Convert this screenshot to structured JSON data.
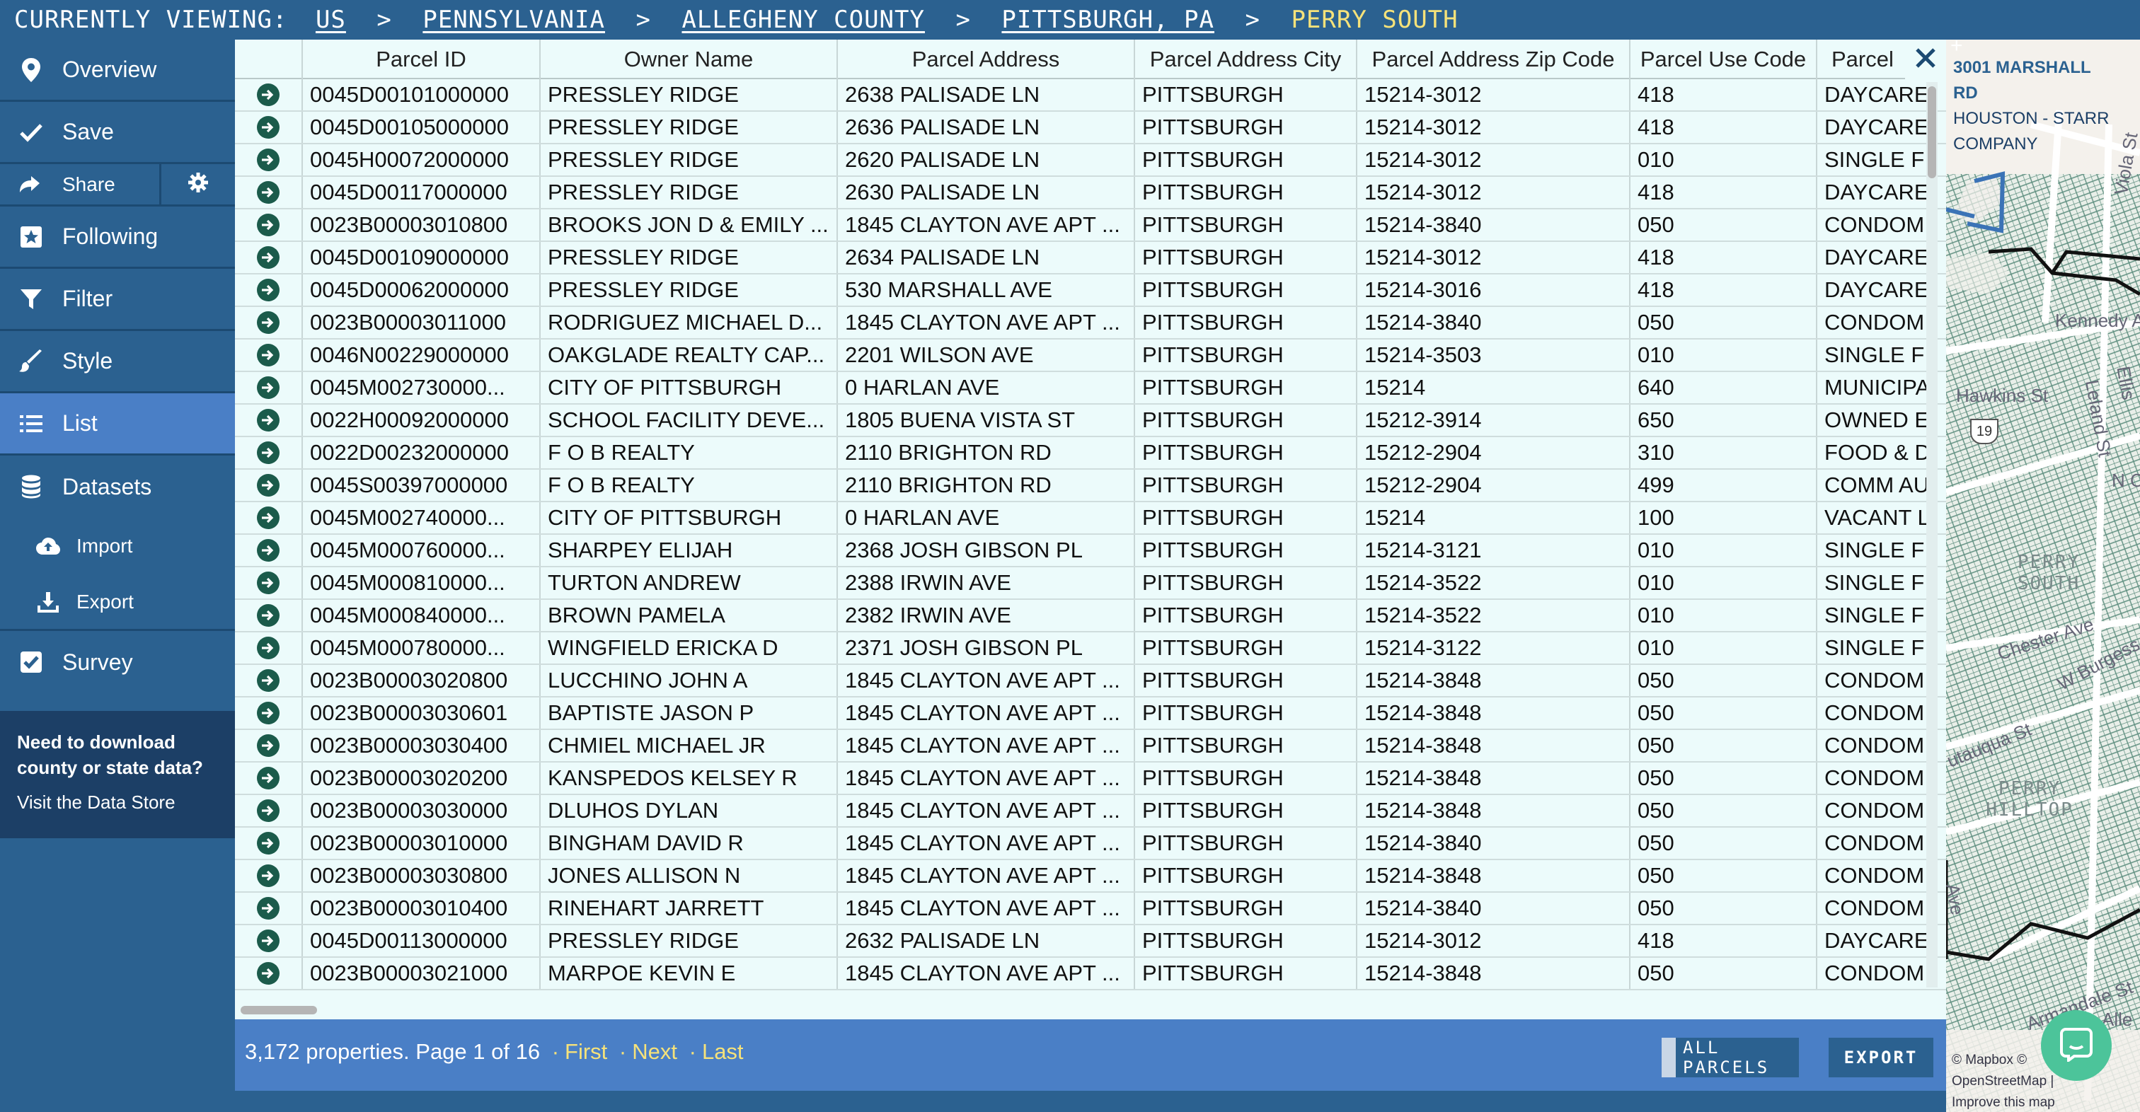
{
  "breadcrumb": {
    "prefix": "CURRENTLY VIEWING:",
    "crumbs": [
      "US",
      "PENNSYLVANIA",
      "ALLEGHENY COUNTY",
      "PITTSBURGH, PA"
    ],
    "separator": ">",
    "current": "PERRY SOUTH"
  },
  "sidebar": {
    "overview": "Overview",
    "save": "Save",
    "share": "Share",
    "following": "Following",
    "filter": "Filter",
    "style": "Style",
    "list": "List",
    "datasets": "Datasets",
    "import": "Import",
    "export": "Export",
    "survey": "Survey",
    "datastore_question": "Need to download county or state data?",
    "datastore_link": "Visit the Data Store"
  },
  "table": {
    "columns": [
      "",
      "Parcel ID",
      "Owner Name",
      "Parcel Address",
      "Parcel Address City",
      "Parcel Address Zip Code",
      "Parcel Use Code",
      "Parcel"
    ],
    "rows": [
      [
        "0045D00101000000",
        "PRESSLEY RIDGE",
        "2638 PALISADE LN",
        "PITTSBURGH",
        "15214-3012",
        "418",
        "DAYCARE"
      ],
      [
        "0045D00105000000",
        "PRESSLEY RIDGE",
        "2636 PALISADE LN",
        "PITTSBURGH",
        "15214-3012",
        "418",
        "DAYCARE"
      ],
      [
        "0045H00072000000",
        "PRESSLEY RIDGE",
        "2620 PALISADE LN",
        "PITTSBURGH",
        "15214-3012",
        "010",
        "SINGLE F"
      ],
      [
        "0045D00117000000",
        "PRESSLEY RIDGE",
        "2630 PALISADE LN",
        "PITTSBURGH",
        "15214-3012",
        "418",
        "DAYCARE"
      ],
      [
        "0023B00003010800",
        "BROOKS JON D & EMILY ...",
        "1845 CLAYTON AVE APT ...",
        "PITTSBURGH",
        "15214-3840",
        "050",
        "CONDOM"
      ],
      [
        "0045D00109000000",
        "PRESSLEY RIDGE",
        "2634 PALISADE LN",
        "PITTSBURGH",
        "15214-3012",
        "418",
        "DAYCARE"
      ],
      [
        "0045D00062000000",
        "PRESSLEY RIDGE",
        "530 MARSHALL AVE",
        "PITTSBURGH",
        "15214-3016",
        "418",
        "DAYCARE"
      ],
      [
        "0023B00003011000",
        "RODRIGUEZ MICHAEL D...",
        "1845 CLAYTON AVE APT ...",
        "PITTSBURGH",
        "15214-3840",
        "050",
        "CONDOM"
      ],
      [
        "0046N00229000000",
        "OAKGLADE REALTY CAP...",
        "2201 WILSON AVE",
        "PITTSBURGH",
        "15214-3503",
        "010",
        "SINGLE F"
      ],
      [
        "0045M002730000...",
        "CITY OF PITTSBURGH",
        "0 HARLAN AVE",
        "PITTSBURGH",
        "15214",
        "640",
        "MUNICIPA"
      ],
      [
        "0022H00092000000",
        "SCHOOL FACILITY DEVE...",
        "1805 BUENA VISTA ST",
        "PITTSBURGH",
        "15212-3914",
        "650",
        "OWNED E"
      ],
      [
        "0022D00232000000",
        "F O B REALTY",
        "2110 BRIGHTON RD",
        "PITTSBURGH",
        "15212-2904",
        "310",
        "FOOD & D"
      ],
      [
        "0045S00397000000",
        "F O B REALTY",
        "2110 BRIGHTON RD",
        "PITTSBURGH",
        "15212-2904",
        "499",
        "COMM AU"
      ],
      [
        "0045M002740000...",
        "CITY OF PITTSBURGH",
        "0 HARLAN AVE",
        "PITTSBURGH",
        "15214",
        "100",
        "VACANT L"
      ],
      [
        "0045M000760000...",
        "SHARPEY ELIJAH",
        "2368 JOSH GIBSON PL",
        "PITTSBURGH",
        "15214-3121",
        "010",
        "SINGLE F"
      ],
      [
        "0045M000810000...",
        "TURTON ANDREW",
        "2388 IRWIN AVE",
        "PITTSBURGH",
        "15214-3522",
        "010",
        "SINGLE F"
      ],
      [
        "0045M000840000...",
        "BROWN PAMELA",
        "2382 IRWIN AVE",
        "PITTSBURGH",
        "15214-3522",
        "010",
        "SINGLE F"
      ],
      [
        "0045M000780000...",
        "WINGFIELD ERICKA D",
        "2371 JOSH GIBSON PL",
        "PITTSBURGH",
        "15214-3122",
        "010",
        "SINGLE F"
      ],
      [
        "0023B00003020800",
        "LUCCHINO JOHN A",
        "1845 CLAYTON AVE APT ...",
        "PITTSBURGH",
        "15214-3848",
        "050",
        "CONDOM"
      ],
      [
        "0023B00003030601",
        "BAPTISTE JASON P",
        "1845 CLAYTON AVE APT ...",
        "PITTSBURGH",
        "15214-3848",
        "050",
        "CONDOM"
      ],
      [
        "0023B00003030400",
        "CHMIEL MICHAEL JR",
        "1845 CLAYTON AVE APT ...",
        "PITTSBURGH",
        "15214-3848",
        "050",
        "CONDOM"
      ],
      [
        "0023B00003020200",
        "KANSPEDOS KELSEY R",
        "1845 CLAYTON AVE APT ...",
        "PITTSBURGH",
        "15214-3848",
        "050",
        "CONDOM"
      ],
      [
        "0023B00003030000",
        "DLUHOS DYLAN",
        "1845 CLAYTON AVE APT ...",
        "PITTSBURGH",
        "15214-3848",
        "050",
        "CONDOM"
      ],
      [
        "0023B00003010000",
        "BINGHAM DAVID R",
        "1845 CLAYTON AVE APT ...",
        "PITTSBURGH",
        "15214-3840",
        "050",
        "CONDOM"
      ],
      [
        "0023B00003030800",
        "JONES ALLISON N",
        "1845 CLAYTON AVE APT ...",
        "PITTSBURGH",
        "15214-3848",
        "050",
        "CONDOM"
      ],
      [
        "0023B00003010400",
        "RINEHART JARRETT",
        "1845 CLAYTON AVE APT ...",
        "PITTSBURGH",
        "15214-3840",
        "050",
        "CONDOM"
      ],
      [
        "0045D00113000000",
        "PRESSLEY RIDGE",
        "2632 PALISADE LN",
        "PITTSBURGH",
        "15214-3012",
        "418",
        "DAYCARE"
      ],
      [
        "0023B00003021000",
        "MARPOE KEVIN E",
        "1845 CLAYTON AVE APT ...",
        "PITTSBURGH",
        "15214-3848",
        "050",
        "CONDOM"
      ]
    ]
  },
  "footer": {
    "summary": "3,172 properties. Page 1 of 16",
    "first": "First",
    "next": "Next",
    "last": "Last",
    "dot": "·",
    "all_parcels": "ALL PARCELS",
    "export": "EXPORT"
  },
  "map": {
    "popup_title": "3001 MARSHALL RD",
    "popup_subtitle": "HOUSTON - STARR COMPANY",
    "labels": [
      "Kennedy Ave",
      "Hawkins St",
      "N C",
      "Chester Ave",
      "W Burgess St",
      "utauqua St",
      "Armandale St",
      "Ave",
      "Viola St",
      "Leland St",
      "Ellis",
      "Alle"
    ],
    "areas": [
      "PERRY SOUTH",
      "PERRY HILLTOP"
    ],
    "route_shield": "19",
    "zoom_in": "+",
    "attribution": "© Mapbox © OpenStreetMap | Improve this map"
  },
  "colors": {
    "brand": "#2b6190",
    "active": "#4a7fc6",
    "accent_text": "#f6e27a",
    "table_bg": "#ecfbfb",
    "row_icon": "#1b5b4b",
    "chat": "#4cc49a"
  },
  "icons": {
    "overview": "map-pin-icon",
    "save": "check-icon",
    "share": "share-arrow-icon",
    "settings": "gear-icon",
    "following": "star-box-icon",
    "filter": "funnel-icon",
    "style": "brush-icon",
    "list": "list-icon",
    "datasets": "database-icon",
    "import": "cloud-upload-icon",
    "export": "download-icon",
    "survey": "checkbox-icon",
    "row": "circle-arrow-right-icon",
    "close": "close-icon",
    "chat": "chat-icon"
  }
}
